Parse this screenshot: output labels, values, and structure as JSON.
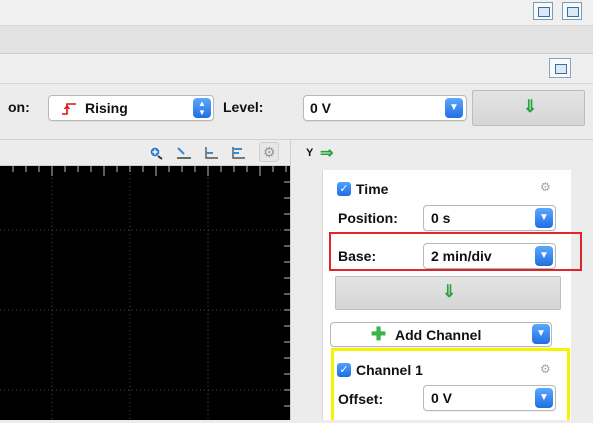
{
  "trigger": {
    "label_partial": "on:",
    "slope_value": "Rising",
    "level_label": "Level:",
    "level_value": "0 V"
  },
  "scope": {
    "toolbar_icons": [
      "zoom-icon",
      "cursor-icon",
      "baseline-icon",
      "level-icon",
      "gear-icon"
    ]
  },
  "panel": {
    "y_label": "Y",
    "time": {
      "title": "Time",
      "checked": true,
      "position_label": "Position:",
      "position_value": "0 s",
      "base_label": "Base:",
      "base_value": "2 min/div"
    },
    "add_channel_label": "Add Channel",
    "channel1": {
      "title": "Channel 1",
      "checked": true,
      "offset_label": "Offset:",
      "offset_value": "0 V"
    }
  },
  "colors": {
    "highlight_red": "#e0262b",
    "highlight_yellow": "#f6f200",
    "accent_blue": "#1f6fe0",
    "arrow_green": "#28a23a"
  }
}
